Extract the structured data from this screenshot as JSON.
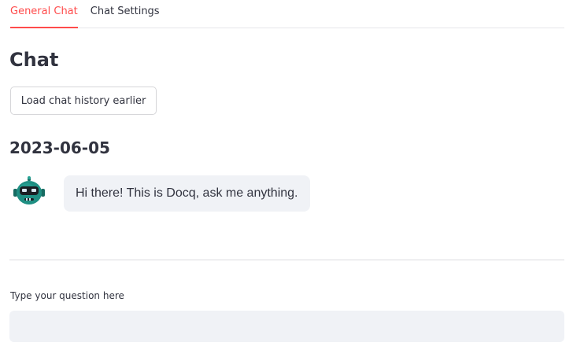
{
  "tabs": [
    {
      "label": "General Chat",
      "active": true
    },
    {
      "label": "Chat Settings",
      "active": false
    }
  ],
  "main": {
    "title": "Chat",
    "load_button_label": "Load chat history earlier",
    "date_heading": "2023-06-05"
  },
  "messages": [
    {
      "sender": "bot",
      "avatar_icon": "robot-avatar-icon",
      "text": "Hi there! This is Docq, ask me anything."
    }
  ],
  "question_input": {
    "label": "Type your question here",
    "value": "",
    "placeholder": ""
  },
  "colors": {
    "accent": "#ff4b4b",
    "bubble_bg": "#f0f2f6",
    "input_bg": "#f0f2f6",
    "text": "#31333f",
    "avatar": "#1f8f83"
  }
}
